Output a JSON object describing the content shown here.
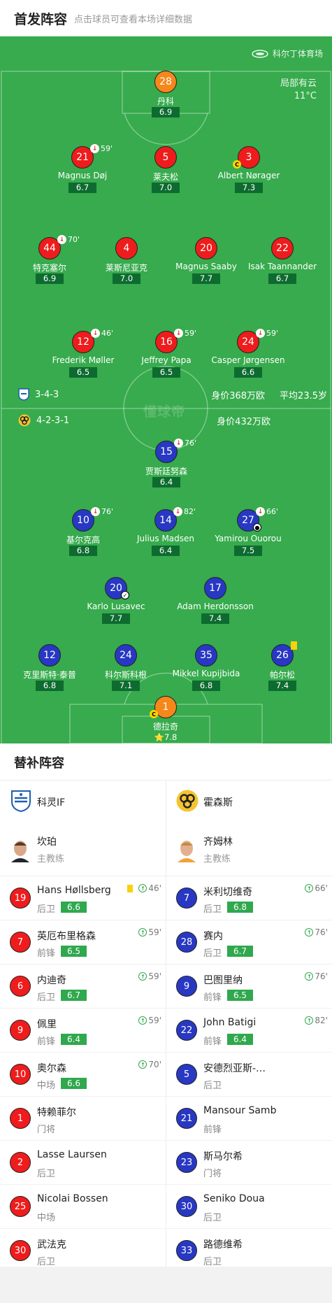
{
  "header": {
    "title": "首发阵容",
    "hint": "点击球员可查看本场详细数据"
  },
  "venue": {
    "name": "科尔丁体育场",
    "weather": "局部有云",
    "temp": "11°C"
  },
  "watermark": "懂球帝",
  "home_team": {
    "formation": "3-4-3",
    "value": "身价368万欧",
    "avg_age": "平均23.5岁"
  },
  "away_team": {
    "formation": "4-2-3-1",
    "value": "身价432万欧"
  },
  "home_players": [
    {
      "number": "28",
      "name": "丹科",
      "rating": "6.9",
      "gk": true
    },
    {
      "number": "21",
      "name": "Magnus Døj",
      "rating": "6.7",
      "sub": "59'"
    },
    {
      "number": "5",
      "name": "莱夫松",
      "rating": "7.0"
    },
    {
      "number": "3",
      "name": "Albert Nørager",
      "rating": "7.3",
      "captain": true
    },
    {
      "number": "44",
      "name": "特克塞尔",
      "rating": "6.9",
      "sub": "70'"
    },
    {
      "number": "4",
      "name": "莱斯尼亚克",
      "rating": "7.0"
    },
    {
      "number": "20",
      "name": "Magnus Saaby",
      "rating": "7.7"
    },
    {
      "number": "22",
      "name": "Isak Taannander",
      "rating": "6.7"
    },
    {
      "number": "12",
      "name": "Frederik Møller",
      "rating": "6.5",
      "sub": "46'"
    },
    {
      "number": "16",
      "name": "Jeffrey Papa",
      "rating": "6.5",
      "sub": "59'"
    },
    {
      "number": "24",
      "name": "Casper Jørgensen",
      "rating": "6.6",
      "sub": "59'"
    }
  ],
  "away_players": [
    {
      "number": "15",
      "name": "贾斯廷努森",
      "rating": "6.4",
      "sub": "76'"
    },
    {
      "number": "10",
      "name": "基尔克高",
      "rating": "6.8",
      "sub": "76'"
    },
    {
      "number": "14",
      "name": "Julius Madsen",
      "rating": "6.4",
      "sub": "82'"
    },
    {
      "number": "27",
      "name": "Yamirou Ouorou",
      "rating": "7.5",
      "sub": "66'"
    },
    {
      "number": "20",
      "name": "Karlo Lusavec",
      "rating": "7.7"
    },
    {
      "number": "17",
      "name": "Adam Herdonsson",
      "rating": "7.4"
    },
    {
      "number": "12",
      "name": "克里斯特·泰普",
      "rating": "6.8"
    },
    {
      "number": "24",
      "name": "科尔斯科根",
      "rating": "7.1"
    },
    {
      "number": "35",
      "name": "Mikkel Kupijbida",
      "rating": "6.8"
    },
    {
      "number": "26",
      "name": "帕尔松",
      "rating": "7.4"
    },
    {
      "number": "1",
      "name": "德拉奇",
      "rating": "7.8",
      "gk": true,
      "captain": true,
      "star": true
    }
  ],
  "subs": {
    "title": "替补阵容",
    "home": {
      "team": "科灵IF",
      "coach": {
        "name": "坎珀",
        "role": "主教练"
      },
      "players": [
        {
          "number": "19",
          "name": "Hans Høllsberg",
          "pos": "后卫",
          "rating": "6.6",
          "min": "46'",
          "yellow": true
        },
        {
          "number": "7",
          "name": "英厄布里格森",
          "pos": "前锋",
          "rating": "6.5",
          "min": "59'"
        },
        {
          "number": "6",
          "name": "内迪奇",
          "pos": "后卫",
          "rating": "6.7",
          "min": "59'"
        },
        {
          "number": "9",
          "name": "佩里",
          "pos": "前锋",
          "rating": "6.4",
          "min": "59'"
        },
        {
          "number": "10",
          "name": "奥尔森",
          "pos": "中场",
          "rating": "6.6",
          "min": "70'"
        },
        {
          "number": "1",
          "name": "特赖菲尔",
          "pos": "门将"
        },
        {
          "number": "2",
          "name": "Lasse Laursen",
          "pos": "后卫"
        },
        {
          "number": "25",
          "name": "Nicolai Bossen",
          "pos": "中场"
        },
        {
          "number": "30",
          "name": "武法克",
          "pos": "后卫"
        }
      ]
    },
    "away": {
      "team": "霍森斯",
      "coach": {
        "name": "齐姆林",
        "role": "主教练"
      },
      "players": [
        {
          "number": "7",
          "name": "米利切维奇",
          "pos": "后卫",
          "rating": "6.8",
          "min": "66'"
        },
        {
          "number": "28",
          "name": "赛内",
          "pos": "后卫",
          "rating": "6.7",
          "min": "76'"
        },
        {
          "number": "9",
          "name": "巴图里纳",
          "pos": "前锋",
          "rating": "6.5",
          "min": "76'"
        },
        {
          "number": "22",
          "name": "John Batigi",
          "pos": "前锋",
          "rating": "6.4",
          "min": "82'"
        },
        {
          "number": "5",
          "name": "安德烈亚斯-…",
          "pos": "后卫"
        },
        {
          "number": "21",
          "name": "Mansour Samb",
          "pos": "前锋"
        },
        {
          "number": "23",
          "name": "斯马尔希",
          "pos": "门将"
        },
        {
          "number": "30",
          "name": "Seniko Doua",
          "pos": "后卫"
        },
        {
          "number": "33",
          "name": "路德维希",
          "pos": "后卫"
        }
      ]
    }
  },
  "colors": {
    "pitch": "#37ab4d",
    "home": "#ee1c1c",
    "away": "#2838c3",
    "gk": "#f7871a",
    "rating_bg": "#0e6b30"
  }
}
